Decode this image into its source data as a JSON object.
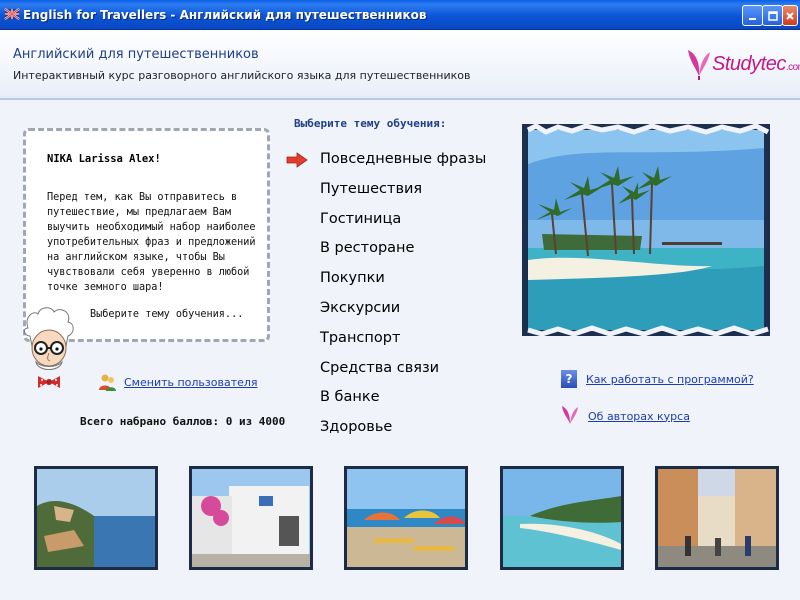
{
  "window": {
    "title": "English for Travellers - Английский для путешественников"
  },
  "header": {
    "title": "Английский для путешественников",
    "subtitle": "Интерактивный курс разговорного английского языка для путешественников",
    "logo_text": "Studytec",
    "logo_suffix": ".com"
  },
  "bubble": {
    "greeting": "NIKA Larissa Alex!",
    "intro": "Перед тем, как Вы отправитесь в путешествие, мы предлагаем Вам выучить необходимый набор наиболее употребительных фраз и предложений на английском языке, чтобы Вы чувствовали себя уверенно в любой точке земного шара!",
    "choose": "Выберите тему обучения..."
  },
  "change_user": {
    "label": "Сменить пользователя",
    "icon": "users-icon"
  },
  "score": {
    "label": "Всего набрано баллов: 0 из 4000"
  },
  "topics": {
    "heading": "Выберите тему обучения:",
    "items": [
      "Повседневные фразы",
      "Путешествия",
      "Гостиница",
      "В ресторане",
      "Покупки",
      "Экскурсии",
      "Транспорт",
      "Средства связи",
      "В банке",
      "Здоровье"
    ],
    "selected": "Повседневные фразы"
  },
  "links": {
    "help": "Как работать с программой?",
    "authors": "Об авторах курса"
  },
  "colors": {
    "title_bar": "#0b55d6",
    "header_title": "#1f3f8a",
    "link": "#1a3db5",
    "logo": "#c2188a",
    "arrow": "#e23c2c"
  }
}
